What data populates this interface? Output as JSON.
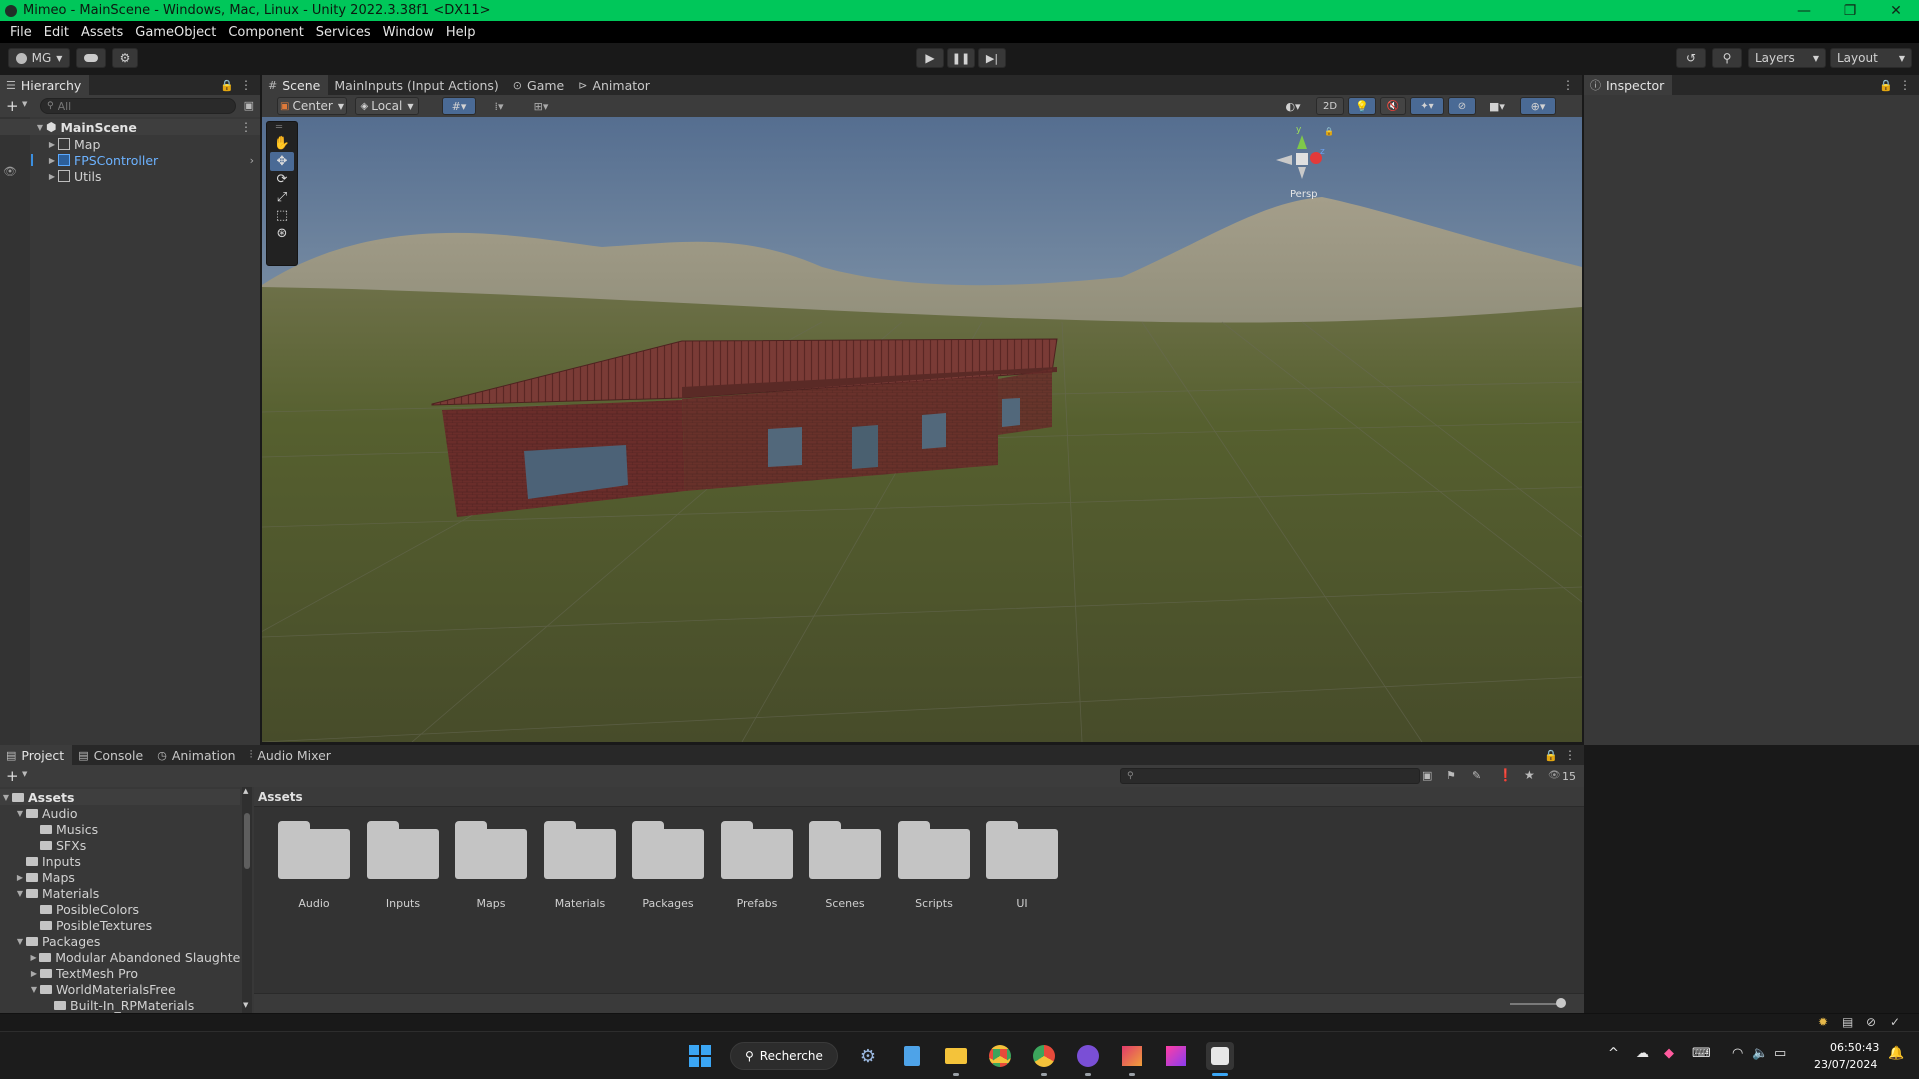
{
  "window": {
    "title": "Mimeo - MainScene - Windows, Mac, Linux - Unity 2022.3.38f1 <DX11>",
    "minimize_icon": "minimize-icon",
    "maximize_icon": "restore-icon",
    "close_icon": "close-icon",
    "min_glyph": "—",
    "max_glyph": "❐",
    "close_glyph": "✕"
  },
  "menubar": [
    "File",
    "Edit",
    "Assets",
    "GameObject",
    "Component",
    "Services",
    "Window",
    "Help"
  ],
  "toolbar": {
    "account_label": "MG",
    "layers_label": "Layers",
    "layout_label": "Layout"
  },
  "hierarchy": {
    "tab_label": "Hierarchy",
    "search_placeholder": "All",
    "scene_name": "MainScene",
    "items": [
      {
        "label": "Map",
        "selected": false
      },
      {
        "label": "FPSController",
        "selected": true
      },
      {
        "label": "Utils",
        "selected": false
      }
    ]
  },
  "scene_tabs": [
    "Scene",
    "MainInputs (Input Actions)",
    "Game",
    "Animator"
  ],
  "scene_toolbar": {
    "pivot_label": "Center",
    "space_label": "Local",
    "mode_2d_label": "2D"
  },
  "gizmo": {
    "projection_label": "Persp",
    "axis_y": "y",
    "axis_z": "z"
  },
  "inspector": {
    "tab_label": "Inspector"
  },
  "bottom_tabs": [
    "Project",
    "Console",
    "Animation",
    "Audio Mixer"
  ],
  "project": {
    "breadcrumb": "Assets",
    "visible_count": "15",
    "tree": [
      {
        "label": "Assets",
        "level": 0,
        "expanded": true,
        "bold": true
      },
      {
        "label": "Audio",
        "level": 1,
        "expanded": true
      },
      {
        "label": "Musics",
        "level": 2,
        "expanded": null
      },
      {
        "label": "SFXs",
        "level": 2,
        "expanded": null
      },
      {
        "label": "Inputs",
        "level": 1,
        "expanded": null
      },
      {
        "label": "Maps",
        "level": 1,
        "expanded": false
      },
      {
        "label": "Materials",
        "level": 1,
        "expanded": true
      },
      {
        "label": "PosibleColors",
        "level": 2,
        "expanded": null
      },
      {
        "label": "PosibleTextures",
        "level": 2,
        "expanded": null
      },
      {
        "label": "Packages",
        "level": 1,
        "expanded": true
      },
      {
        "label": "Modular Abandoned Slaughterh",
        "level": 2,
        "expanded": false
      },
      {
        "label": "TextMesh Pro",
        "level": 2,
        "expanded": false
      },
      {
        "label": "WorldMaterialsFree",
        "level": 2,
        "expanded": true
      },
      {
        "label": "Built-In_RPMaterials",
        "level": 3,
        "expanded": null
      }
    ],
    "folders": [
      "Audio",
      "Inputs",
      "Maps",
      "Materials",
      "Packages",
      "Prefabs",
      "Scenes",
      "Scripts",
      "UI"
    ]
  },
  "taskbar": {
    "search_label": "Recherche",
    "time": "06:50:43",
    "date": "23/07/2024"
  }
}
